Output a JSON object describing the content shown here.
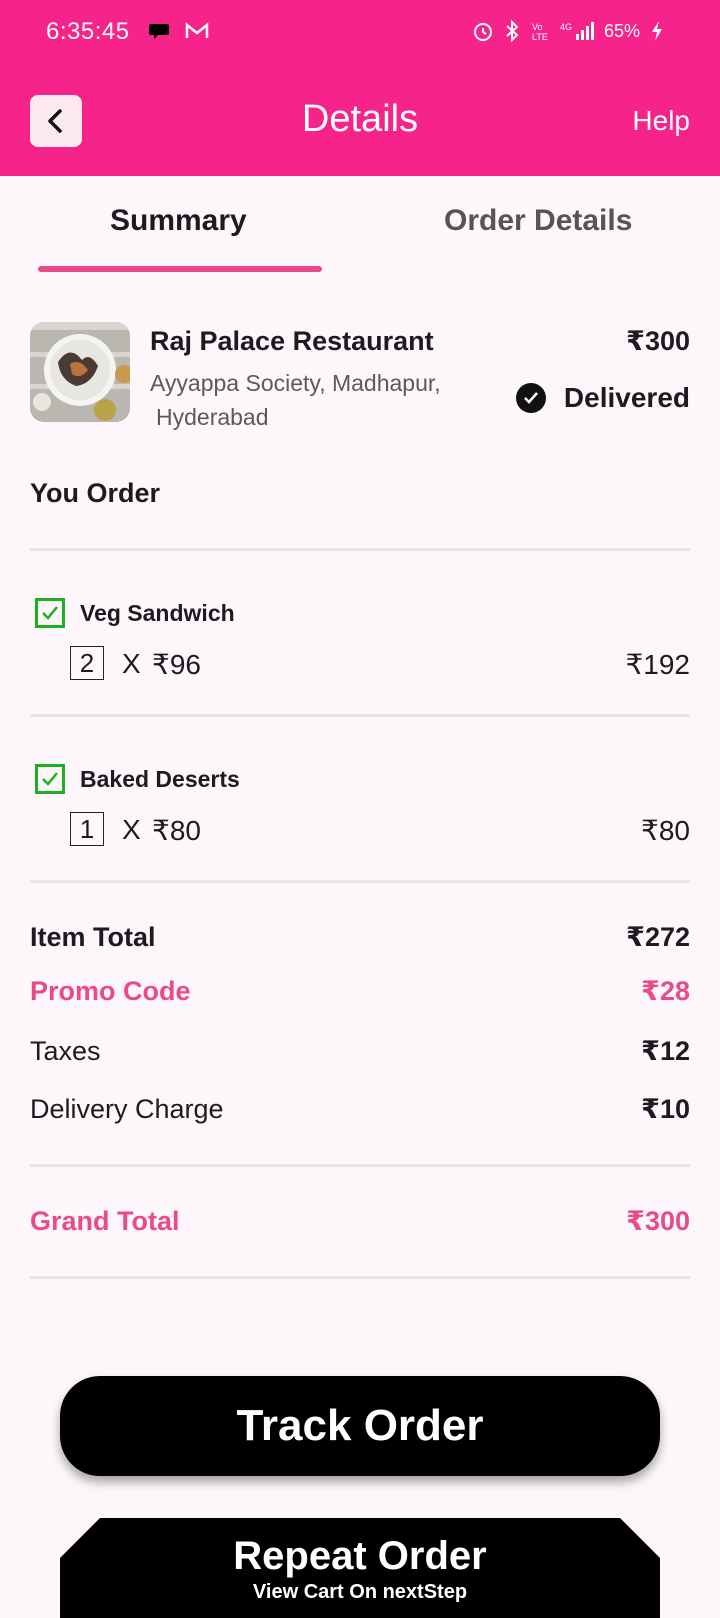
{
  "status_bar": {
    "time": "6:35:45",
    "battery": "65%"
  },
  "app_bar": {
    "title": "Details",
    "help": "Help",
    "back_icon": "chevron-left-icon"
  },
  "tabs": [
    {
      "label": "Summary",
      "active": true
    },
    {
      "label": "Order Details",
      "active": false
    }
  ],
  "restaurant": {
    "name": "Raj Palace Restaurant",
    "address_line1": "Ayyappa Society, Madhapur,",
    "address_line2": "Hyderabad",
    "price": "₹300",
    "status": "Delivered"
  },
  "order_section_title": "You Order",
  "items": [
    {
      "name": "Veg Sandwich",
      "qty": "2",
      "mult": "X",
      "unit_price": "₹96",
      "total": "₹192"
    },
    {
      "name": "Baked Deserts",
      "qty": "1",
      "mult": "X",
      "unit_price": "₹80",
      "total": "₹80"
    }
  ],
  "summary": {
    "item_total_label": "Item Total",
    "item_total": "₹272",
    "promo_label": "Promo Code",
    "promo": "₹28",
    "taxes_label": "Taxes",
    "taxes": "₹12",
    "delivery_label": "Delivery Charge",
    "delivery": "₹10",
    "grand_total_label": "Grand Total",
    "grand_total": "₹300"
  },
  "actions": {
    "track": "Track Order",
    "repeat": "Repeat Order",
    "repeat_sub": "View Cart On nextStep"
  },
  "colors": {
    "brand": "#f5238a",
    "accent": "#e94a8c",
    "veg_green": "#1db21d"
  }
}
